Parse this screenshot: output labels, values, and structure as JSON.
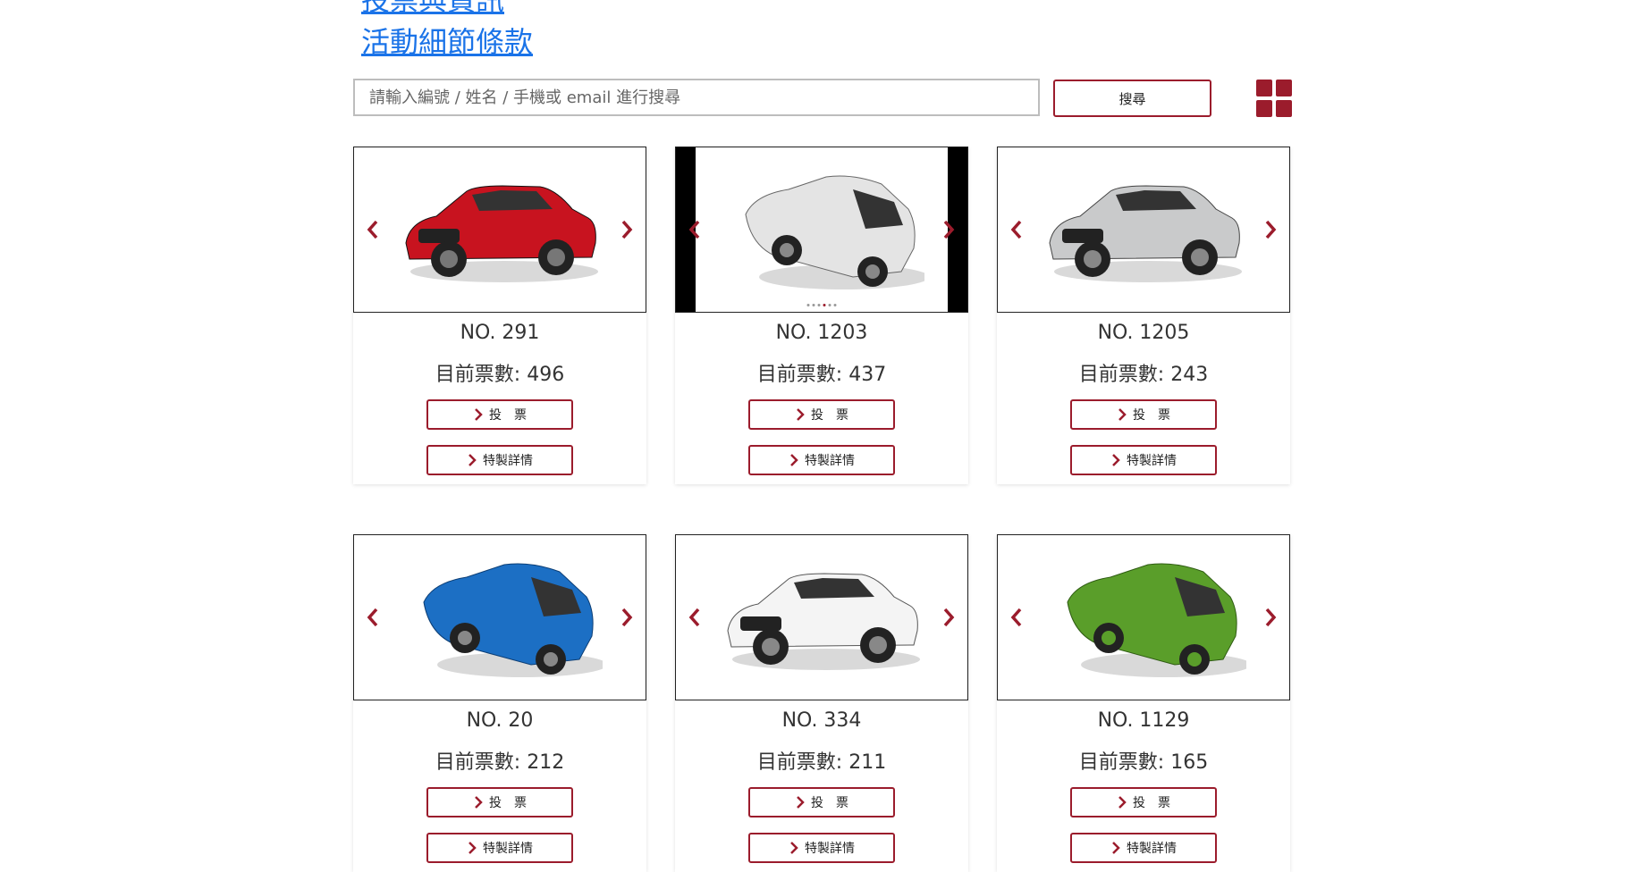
{
  "links": {
    "top_partial": "投票與資訊",
    "terms": "活動細節條款"
  },
  "search": {
    "placeholder": "請輸入編號 / 姓名 / 手機或 email 進行搜尋",
    "value": "",
    "button_label": "搜尋"
  },
  "view_toggle": {
    "icon": "grid-icon"
  },
  "colors": {
    "accent": "#9b1c2c",
    "link": "#1a73e8"
  },
  "cards": [
    {
      "no": "NO. 291",
      "votes": "目前票數: 496",
      "car_color": "#c8131f",
      "vote_label": "投票",
      "detail_label": "特製詳情"
    },
    {
      "no": "NO. 1203",
      "votes": "目前票數: 437",
      "car_color": "#e4e4e4",
      "vote_label": "投票",
      "detail_label": "特製詳情"
    },
    {
      "no": "NO. 1205",
      "votes": "目前票數: 243",
      "car_color": "#c9cacb",
      "vote_label": "投票",
      "detail_label": "特製詳情"
    },
    {
      "no": "NO. 20",
      "votes": "目前票數: 212",
      "car_color": "#1c6fc4",
      "vote_label": "投票",
      "detail_label": "特製詳情"
    },
    {
      "no": "NO. 334",
      "votes": "目前票數: 211",
      "car_color": "#f4f4f4",
      "vote_label": "投票",
      "detail_label": "特製詳情"
    },
    {
      "no": "NO. 1129",
      "votes": "目前票數: 165",
      "car_color": "#5a9e2a",
      "vote_label": "投票",
      "detail_label": "特製詳情"
    }
  ]
}
